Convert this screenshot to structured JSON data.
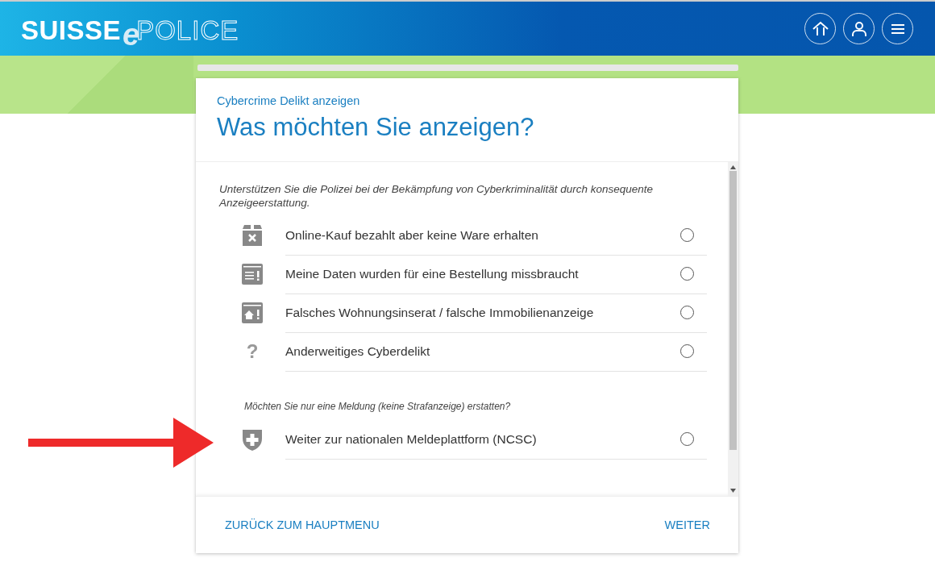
{
  "logo": {
    "word": "SUISSE",
    "letter": "e",
    "outline": "POLICE"
  },
  "header_buttons": [
    {
      "kind": "home"
    },
    {
      "kind": "user"
    },
    {
      "kind": "menu"
    }
  ],
  "card": {
    "breadcrumb": "Cybercrime Delikt anzeigen",
    "title": "Was möchten Sie anzeigen?",
    "sections": [
      {
        "prompt": "Unterstützen Sie die Polizei bei der Bekämpfung von Cyberkriminalität durch konsequente Anzeigeerstattung.",
        "indented": false,
        "options": [
          {
            "kind": "box-x",
            "label": "Online-Kauf bezahlt aber keine Ware erhalten",
            "selected": false
          },
          {
            "kind": "window-alert",
            "label": "Meine Daten wurden für eine Bestellung missbraucht",
            "selected": false
          },
          {
            "kind": "house-alert",
            "label": "Falsches Wohnungsinserat / falsche Immobilienanzeige",
            "selected": false
          },
          {
            "kind": "char",
            "icon": "?",
            "label": "Anderweitiges Cyberdelikt",
            "selected": false
          }
        ]
      },
      {
        "prompt": "Möchten Sie nur eine Meldung (keine Strafanzeige) erstatten?",
        "indented": true,
        "options": [
          {
            "kind": "shield",
            "label": "Weiter zur nationalen Meldeplattform (NCSC)",
            "selected": false
          }
        ]
      }
    ],
    "footer": {
      "back": "ZURÜCK ZUM HAUPTMENU",
      "next": "WEITER"
    }
  }
}
